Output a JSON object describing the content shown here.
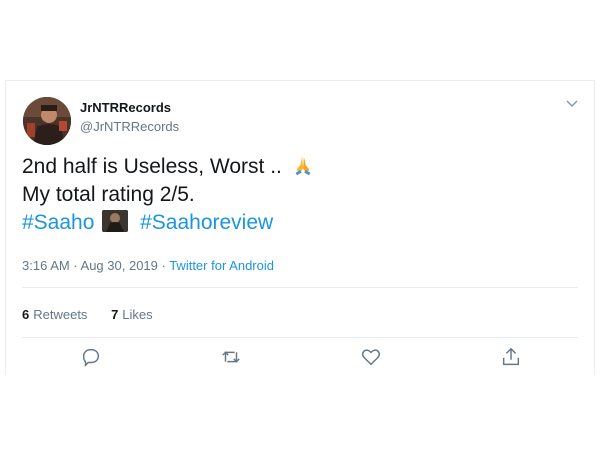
{
  "tweet": {
    "display_name": "JrNTRRecords",
    "handle": "@JrNTRRecords",
    "lines": {
      "line1": "2nd half is Useless, Worst ..",
      "line2": "My total rating 2/5."
    },
    "hashtags": [
      "#Saaho",
      "#Saahoreview"
    ],
    "time": "3:16 AM · Aug 30, 2019 · ",
    "source": "Twitter for Android",
    "retweets_count": "6",
    "retweets_label": "Retweets",
    "likes_count": "7",
    "likes_label": "Likes"
  },
  "colors": {
    "link": "#1b95e0",
    "text": "#14171a",
    "secondary": "#657786",
    "border": "#e6ecf0"
  },
  "icons": {
    "chevron": "chevron-down-icon",
    "reply": "reply-icon",
    "retweet": "retweet-icon",
    "like": "heart-icon",
    "share": "share-icon",
    "emoji": "folded-hands-emoji"
  }
}
